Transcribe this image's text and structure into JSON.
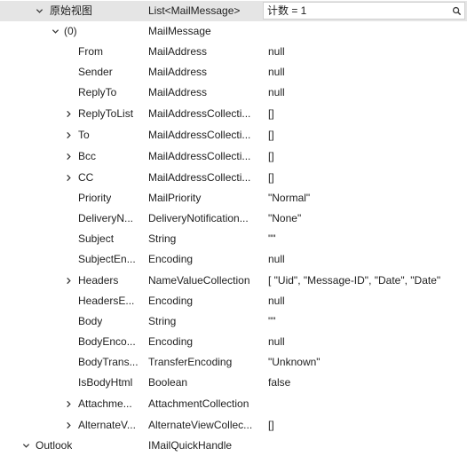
{
  "search": {
    "query": "计数 = 1",
    "icon": "search-icon"
  },
  "rows": [
    {
      "name": "原始视图",
      "type": "List<MailMessage>",
      "value": ""
    },
    {
      "name": "(0)",
      "type": "MailMessage",
      "value": ""
    },
    {
      "name": "From",
      "type": "MailAddress",
      "value": "null"
    },
    {
      "name": "Sender",
      "type": "MailAddress",
      "value": "null"
    },
    {
      "name": "ReplyTo",
      "type": "MailAddress",
      "value": "null"
    },
    {
      "name": "ReplyToList",
      "type": "MailAddressCollecti...",
      "value": "[]"
    },
    {
      "name": "To",
      "type": "MailAddressCollecti...",
      "value": "[]"
    },
    {
      "name": "Bcc",
      "type": "MailAddressCollecti...",
      "value": "[]"
    },
    {
      "name": "CC",
      "type": "MailAddressCollecti...",
      "value": "[]"
    },
    {
      "name": "Priority",
      "type": "MailPriority",
      "value": "\"Normal\""
    },
    {
      "name": "DeliveryN...",
      "type": "DeliveryNotification...",
      "value": "\"None\""
    },
    {
      "name": "Subject",
      "type": "String",
      "value": "\"\""
    },
    {
      "name": "SubjectEn...",
      "type": "Encoding",
      "value": "null"
    },
    {
      "name": "Headers",
      "type": "NameValueCollection",
      "value": "[  \"Uid\",  \"Message-ID\",  \"Date\",  \"Date\""
    },
    {
      "name": "HeadersE...",
      "type": "Encoding",
      "value": "null"
    },
    {
      "name": "Body",
      "type": "String",
      "value": "\"\""
    },
    {
      "name": "BodyEnco...",
      "type": "Encoding",
      "value": "null"
    },
    {
      "name": "BodyTrans...",
      "type": "TransferEncoding",
      "value": "\"Unknown\""
    },
    {
      "name": "IsBodyHtml",
      "type": "Boolean",
      "value": "false"
    },
    {
      "name": "Attachme...",
      "type": "AttachmentCollection",
      "value": ""
    },
    {
      "name": "AlternateV...",
      "type": "AlternateViewCollec...",
      "value": "[]"
    },
    {
      "name": "Outlook",
      "type": "IMailQuickHandle",
      "value": ""
    }
  ]
}
